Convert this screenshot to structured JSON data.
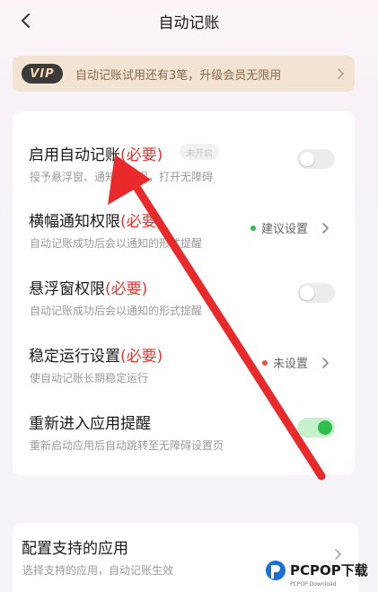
{
  "header": {
    "title": "自动记账"
  },
  "vip_banner": {
    "badge": "VIP",
    "text": "自动记账试用还有3笔，升级会员无限用"
  },
  "settings": [
    {
      "title": "启用自动记账",
      "required": "(必要)",
      "badge": "未开启",
      "subtitle": "授予悬浮窗、通知栏权限，打开无障碍",
      "control": "toggle",
      "enabled": false
    },
    {
      "title": "横幅通知权限",
      "required": "(必要)",
      "subtitle": "自动记账成功后会以通知的形式提醒",
      "control": "status",
      "status_text": "建议设置",
      "status_color": "#2fbf4a"
    },
    {
      "title": "悬浮窗权限",
      "required": "(必要)",
      "subtitle": "自动记账成功后会以通知的形式提醒",
      "control": "toggle",
      "enabled": false
    },
    {
      "title": "稳定运行设置",
      "required": "(必要)",
      "subtitle": "使自动记账长期稳定运行",
      "control": "status",
      "status_text": "未设置",
      "status_color": "#e8523f"
    },
    {
      "title": "重新进入应用提醒",
      "subtitle": "重新启动应用后自动跳转至无障碍设置页",
      "control": "toggle",
      "enabled": true
    }
  ],
  "supported_apps": {
    "title": "配置支持的应用",
    "subtitle": "选择支持的应用，自动记账生效"
  },
  "watermark": {
    "brand": "PCPOP下载",
    "small": "PCPOP Download"
  },
  "colors": {
    "accent_red": "#e8352f",
    "toggle_on": "#2fbf4a",
    "vip_bg": "#f3e3d3"
  }
}
